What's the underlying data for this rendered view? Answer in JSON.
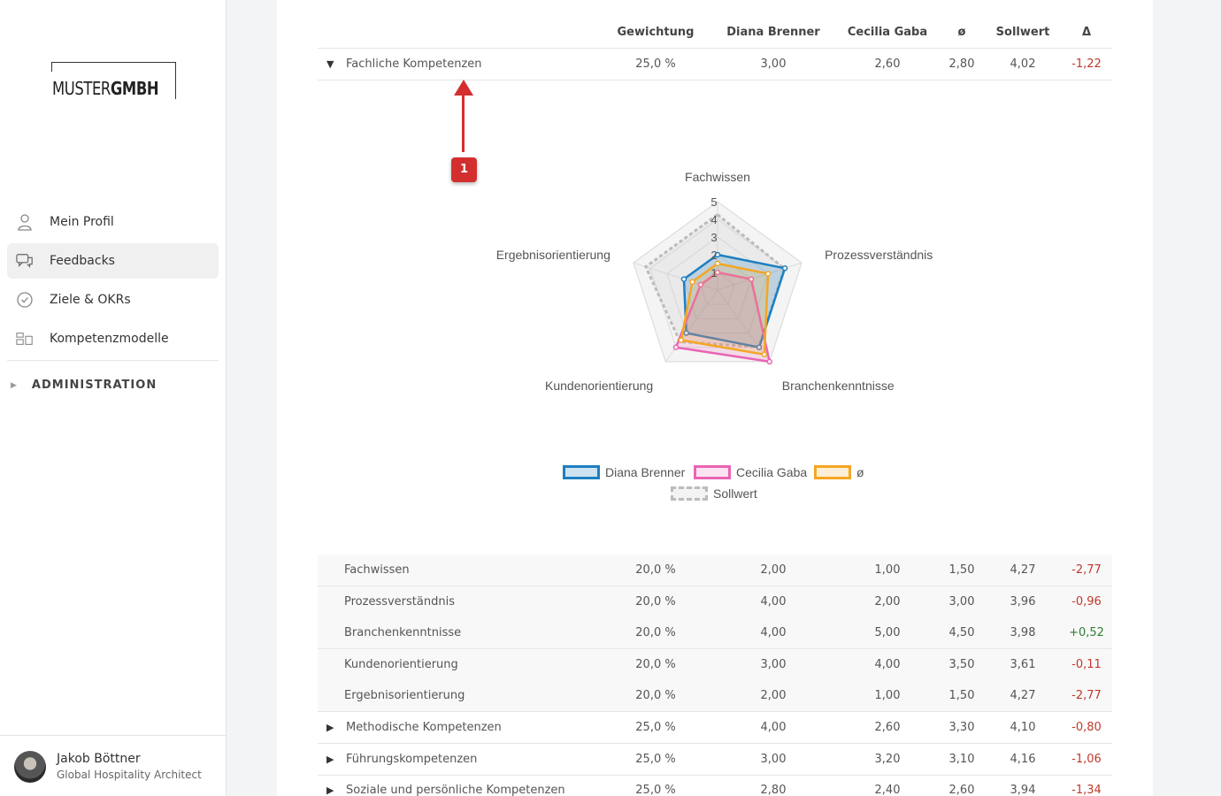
{
  "logo": {
    "part1": "MUSTER",
    "part2": "GMBH"
  },
  "nav": [
    {
      "label": "Mein Profil",
      "icon": "user-icon"
    },
    {
      "label": "Feedbacks",
      "icon": "chat-icon"
    },
    {
      "label": "Ziele & OKRs",
      "icon": "check-circle-icon"
    },
    {
      "label": "Kompetenzmodelle",
      "icon": "grid-icon"
    }
  ],
  "admin_label": "ADMINISTRATION",
  "user": {
    "name": "Jakob Böttner",
    "role": "Global Hospitality Architect"
  },
  "columns": [
    "Gewichtung",
    "Diana Brenner",
    "Cecilia Gaba",
    "ø",
    "Sollwert",
    "Δ"
  ],
  "group_row": {
    "name": "Fachliche Kompetenzen",
    "values": [
      "25,0 %",
      "3,00",
      "2,60",
      "2,80",
      "4,02",
      "-1,22"
    ]
  },
  "annotation": {
    "number": "1"
  },
  "sub_rows": [
    {
      "name": "Fachwissen",
      "values": [
        "20,0 %",
        "2,00",
        "1,00",
        "1,50",
        "4,27",
        "-2,77"
      ]
    },
    {
      "name": "Prozessverständnis",
      "values": [
        "20,0 %",
        "4,00",
        "2,00",
        "3,00",
        "3,96",
        "-0,96"
      ]
    },
    {
      "name": "Branchenkenntnisse",
      "values": [
        "20,0 %",
        "4,00",
        "5,00",
        "4,50",
        "3,98",
        "+0,52"
      ]
    },
    {
      "name": "Kundenorientierung",
      "values": [
        "20,0 %",
        "3,00",
        "4,00",
        "3,50",
        "3,61",
        "-0,11"
      ]
    },
    {
      "name": "Ergebnisorientierung",
      "values": [
        "20,0 %",
        "2,00",
        "1,00",
        "1,50",
        "4,27",
        "-2,77"
      ]
    }
  ],
  "other_rows": [
    {
      "name": "Methodische Kompetenzen",
      "values": [
        "25,0 %",
        "4,00",
        "2,60",
        "3,30",
        "4,10",
        "-0,80"
      ]
    },
    {
      "name": "Führungskompetenzen",
      "values": [
        "25,0 %",
        "3,00",
        "3,20",
        "3,10",
        "4,16",
        "-1,06"
      ]
    },
    {
      "name": "Soziale und persönliche Kompetenzen",
      "values": [
        "25,0 %",
        "2,80",
        "2,40",
        "2,60",
        "3,94",
        "-1,34"
      ]
    }
  ],
  "colors": {
    "diana": "#1e7fc0",
    "cecilia": "#e964b4",
    "avg": "#f5a623",
    "soll": "#bbbbbb",
    "negative": "#c0392b",
    "positive": "#2e7d32"
  },
  "chart_data": {
    "type": "radar",
    "axes": [
      "Fachwissen",
      "Prozessverständnis",
      "Branchenkenntnisse",
      "Kundenorientierung",
      "Ergebnisorientierung"
    ],
    "ticks": [
      "1",
      "2",
      "3",
      "4",
      "5"
    ],
    "range": [
      0,
      5
    ],
    "series": [
      {
        "name": "Diana Brenner",
        "values": [
          2,
          4,
          4,
          3,
          2
        ]
      },
      {
        "name": "Cecilia Gaba",
        "values": [
          1,
          2,
          5,
          4,
          1
        ]
      },
      {
        "name": "ø",
        "values": [
          1.5,
          3,
          4.5,
          3.5,
          1.5
        ]
      },
      {
        "name": "Sollwert",
        "values": [
          4.27,
          3.96,
          3.98,
          3.61,
          4.27
        ]
      }
    ],
    "legend_position": "bottom"
  }
}
